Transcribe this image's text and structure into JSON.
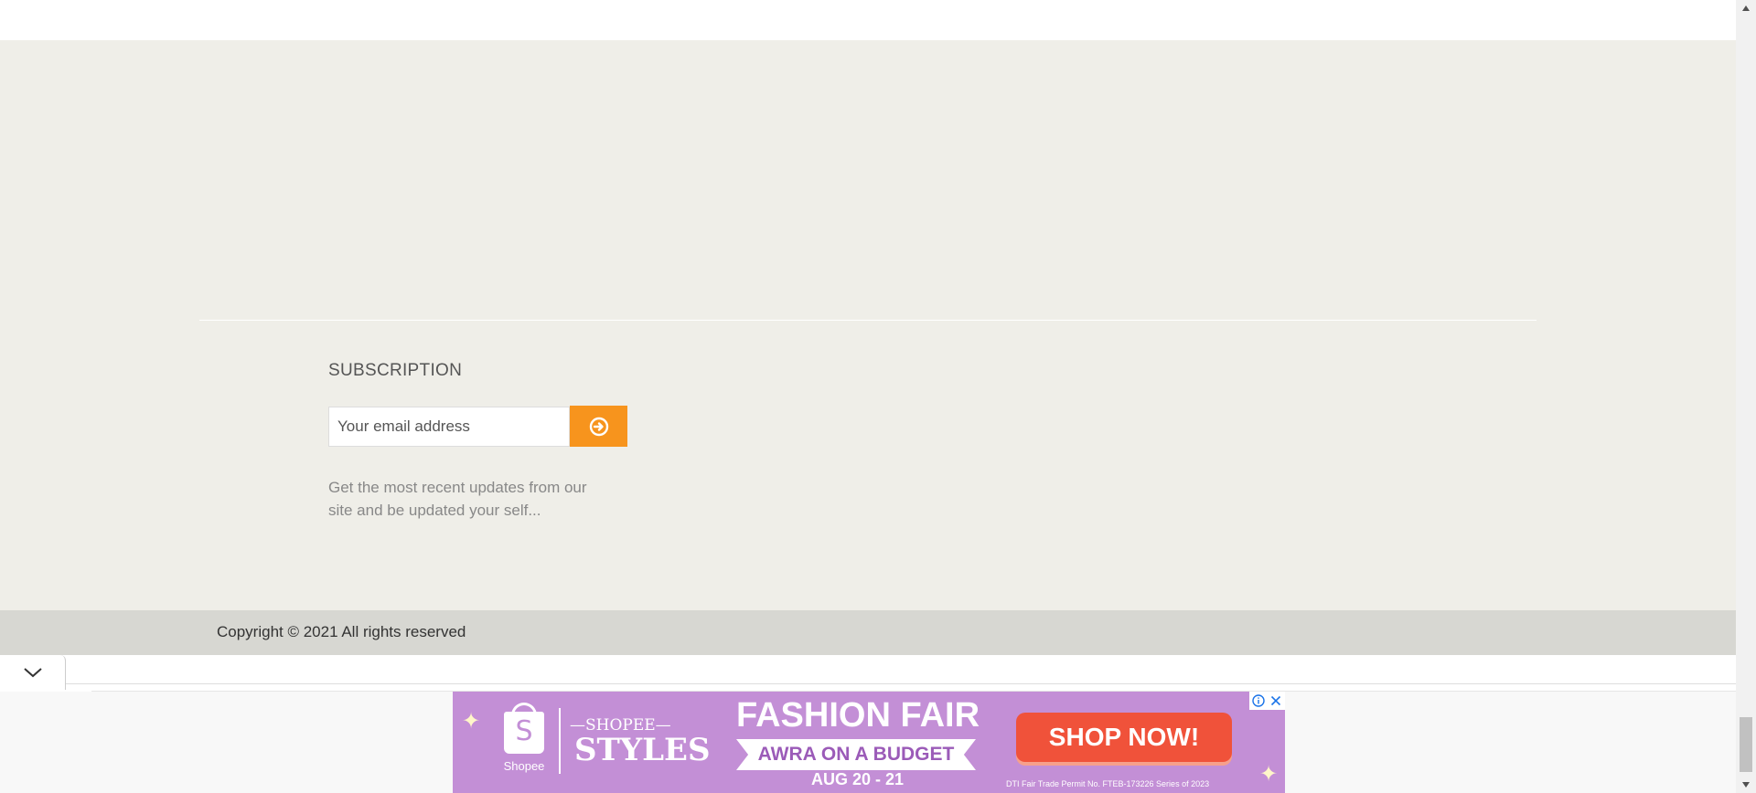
{
  "subscription": {
    "title": "SUBSCRIPTION",
    "email_placeholder": "Your email address",
    "submit_icon": "circle-arrow-right-icon",
    "description": "Get the most recent updates from our site and be updated your self..."
  },
  "footer": {
    "copyright": "Copyright © 2021 All rights reserved"
  },
  "collapse": {
    "icon": "chevron-down-icon"
  },
  "ad": {
    "brand": "Shopee",
    "brand_logo_letter": "S",
    "styles_top": "—SHOPEE—",
    "styles": "STYLES",
    "headline": "FASHION FAIR",
    "ribbon": "AWRA ON A BUDGET",
    "dates": "AUG 20 - 21",
    "cta": "SHOP NOW!",
    "permit": "DTI Fair Trade Permit No. FTEB-173226 Series of 2023",
    "info_icon": "info-icon",
    "close_icon": "close-icon",
    "background_color": "#c38fd6",
    "cta_color": "#f0523a"
  },
  "colors": {
    "footer_bg": "#efeee8",
    "copyright_bg": "#d7d7d2",
    "accent": "#f7941d"
  }
}
